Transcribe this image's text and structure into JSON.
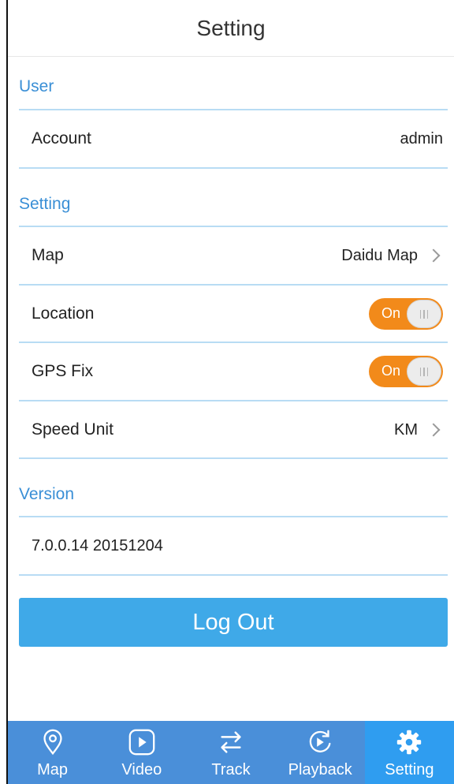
{
  "header": {
    "title": "Setting"
  },
  "sections": {
    "user": {
      "label": "User"
    },
    "setting": {
      "label": "Setting"
    },
    "version": {
      "label": "Version"
    }
  },
  "account": {
    "label": "Account",
    "value": "admin"
  },
  "map": {
    "label": "Map",
    "value": "Daidu Map",
    "icon": "chevron-right-icon"
  },
  "location": {
    "label": "Location",
    "toggle_text": "On",
    "enabled": true
  },
  "gps_fix": {
    "label": "GPS Fix",
    "toggle_text": "On",
    "enabled": true
  },
  "speed_unit": {
    "label": "Speed Unit",
    "value": "KM",
    "icon": "chevron-right-icon"
  },
  "version": {
    "value": "7.0.0.14 20151204"
  },
  "logout": {
    "label": "Log Out"
  },
  "colors": {
    "accent": "#3a8fd6",
    "toggle_on": "#f28a1a",
    "tabbar": "#4a8fd9",
    "tab_active": "#2f9df0",
    "button": "#3fa9e8"
  },
  "tabs": [
    {
      "label": "Map",
      "icon": "map-pin-icon",
      "active": false
    },
    {
      "label": "Video",
      "icon": "play-icon",
      "active": false
    },
    {
      "label": "Track",
      "icon": "swap-arrows-icon",
      "active": false
    },
    {
      "label": "Playback",
      "icon": "replay-icon",
      "active": false
    },
    {
      "label": "Setting",
      "icon": "gear-icon",
      "active": true
    }
  ]
}
